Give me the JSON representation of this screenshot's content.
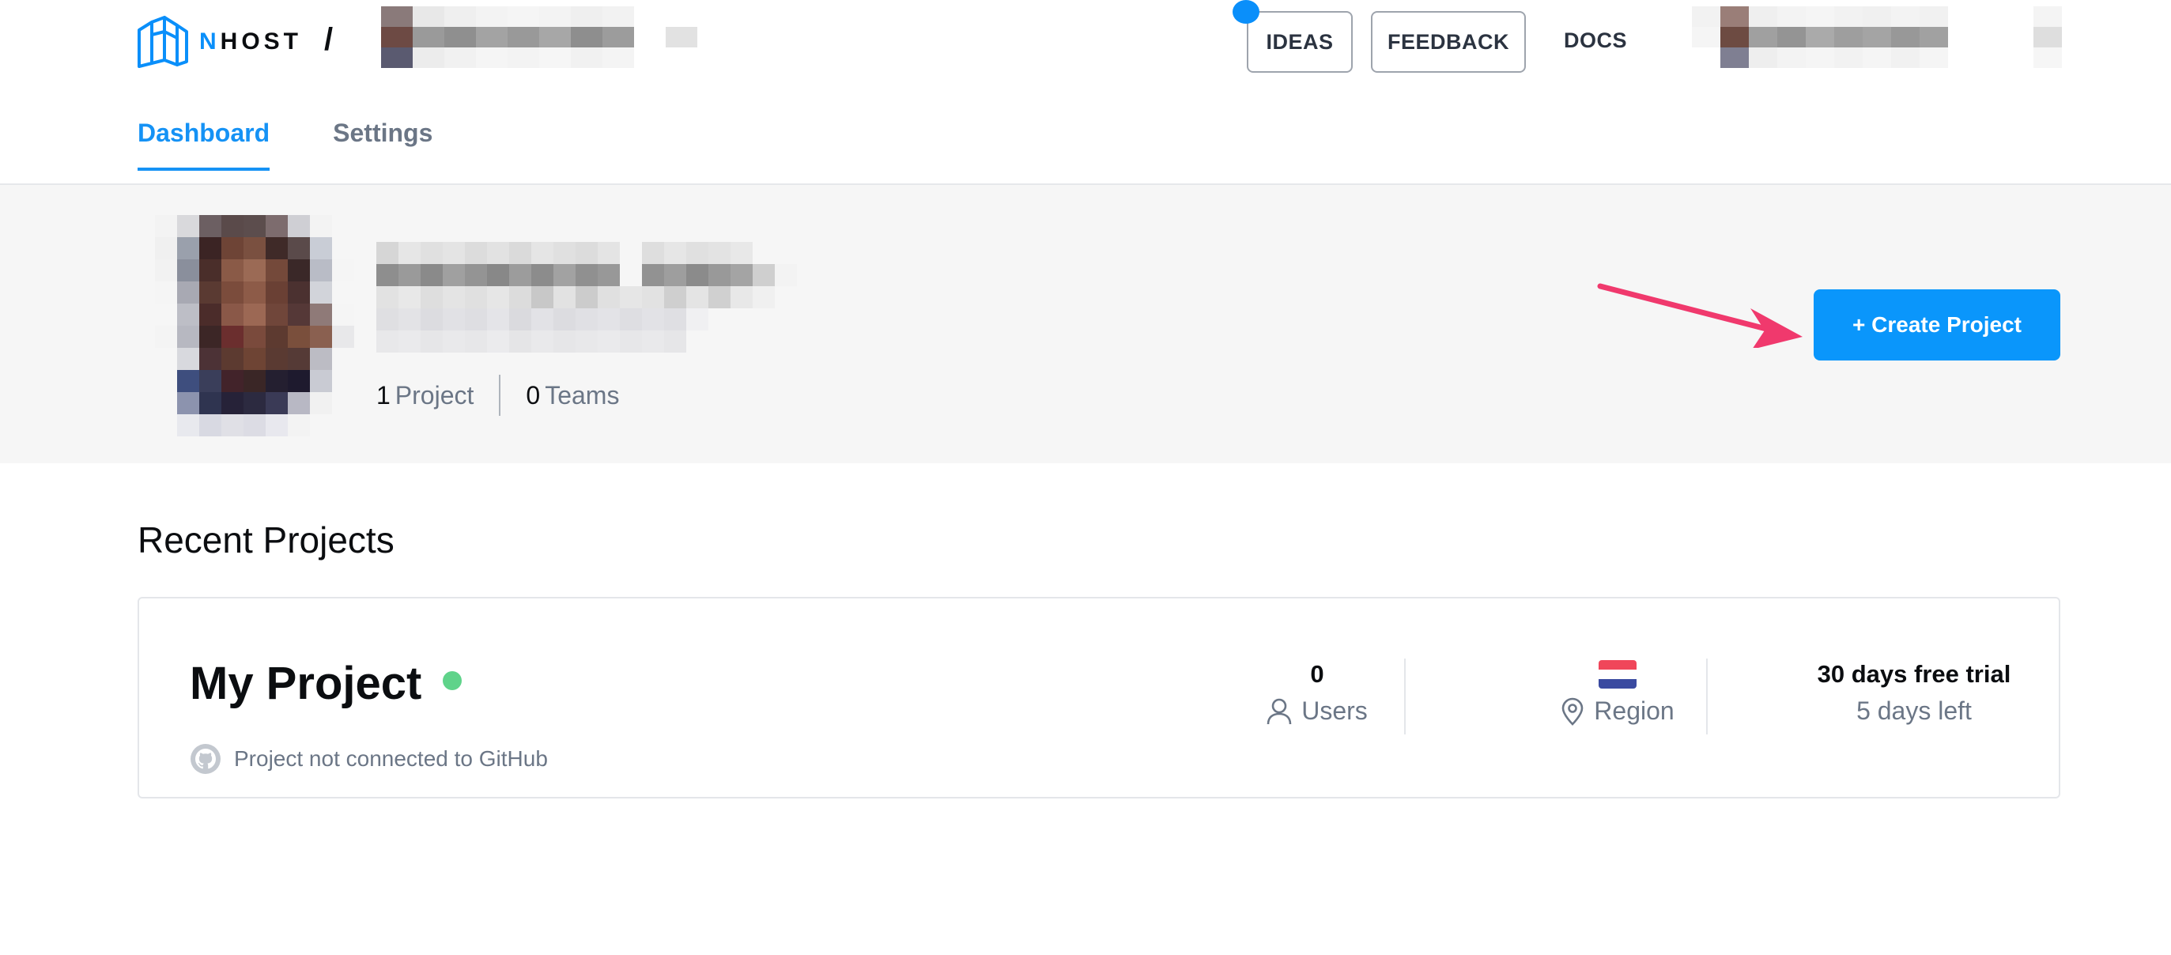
{
  "brand": {
    "logo_text": "NHOST",
    "logo_accent": "#0a8ffa",
    "slash": "/"
  },
  "header": {
    "ideas_label": "IDEAS",
    "feedback_label": "FEEDBACK",
    "docs_label": "DOCS",
    "notification_dot_color": "#0a8ffa"
  },
  "tabs": [
    {
      "label": "Dashboard",
      "active": true
    },
    {
      "label": "Settings",
      "active": false
    }
  ],
  "profile": {
    "projects_count": "1",
    "projects_label": "Project",
    "teams_count": "0",
    "teams_label": "Teams",
    "create_button": "+ Create Project"
  },
  "recent": {
    "title": "Recent Projects",
    "projects": [
      {
        "name": "My Project",
        "status_color": "#5fd38a",
        "github_text": "Project not connected to GitHub",
        "users_count": "0",
        "users_label": "Users",
        "region_label": "Region",
        "region_flag": "netherlands-flag",
        "trial_title": "30 days free trial",
        "trial_remaining": "5 days left"
      }
    ]
  },
  "icons": {
    "logo": "nhost-logo-icon",
    "user": "user-icon",
    "location": "location-pin-icon",
    "github": "github-icon",
    "arrow": "annotation-arrow"
  },
  "colors": {
    "primary": "#0a96fb",
    "muted_text": "#6b7686",
    "arrow": "#f0396d"
  }
}
